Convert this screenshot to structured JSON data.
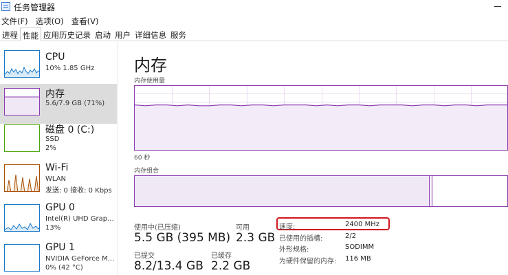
{
  "window": {
    "title": "任务管理器"
  },
  "menu": [
    "文件(F)",
    "选项(O)",
    "查看(V)"
  ],
  "tabs": [
    "进程",
    "性能",
    "应用历史记录",
    "启动",
    "用户",
    "详细信息",
    "服务"
  ],
  "active_tab": "性能",
  "sidebar": {
    "items": [
      {
        "title": "CPU",
        "sub1": "10% 1.85 GHz",
        "sub2": "",
        "color": "#1979ca"
      },
      {
        "title": "内存",
        "sub1": "5.6/7.9 GB (71%)",
        "sub2": "",
        "color": "#8b3db0"
      },
      {
        "title": "磁盘 0 (C:)",
        "sub1": "SSD",
        "sub2": "2%",
        "color": "#4da60c"
      },
      {
        "title": "Wi-Fi",
        "sub1": "WLAN",
        "sub2": "发送: 0 接收: 0 Kbps",
        "color": "#a74f01"
      },
      {
        "title": "GPU 0",
        "sub1": "Intel(R) UHD Grap...",
        "sub2": "13%",
        "color": "#1979ca"
      },
      {
        "title": "GPU 1",
        "sub1": "NVIDIA GeForce M...",
        "sub2": "0% (42 °C)",
        "color": "#1979ca"
      }
    ]
  },
  "main": {
    "title": "内存",
    "usage_label": "内存使用量",
    "time_label": "60 秒",
    "composition_label": "内存组合",
    "memory_usage_level": 0.71,
    "stats": {
      "in_use_label": "使用中(已压缩)",
      "in_use_value": "5.5 GB (395 MB)",
      "available_label": "可用",
      "available_value": "2.3 GB",
      "committed_label": "已提交",
      "committed_value": "8.2/13.4 GB",
      "cached_label": "已缓存",
      "cached_value": "2.2 GB"
    },
    "info": [
      {
        "label": "速度:",
        "value": "2400 MHz"
      },
      {
        "label": "已使用的插槽:",
        "value": "2/2"
      },
      {
        "label": "外形规格:",
        "value": "SODIMM"
      },
      {
        "label": "为硬件保留的内存:",
        "value": "116 MB"
      }
    ]
  }
}
